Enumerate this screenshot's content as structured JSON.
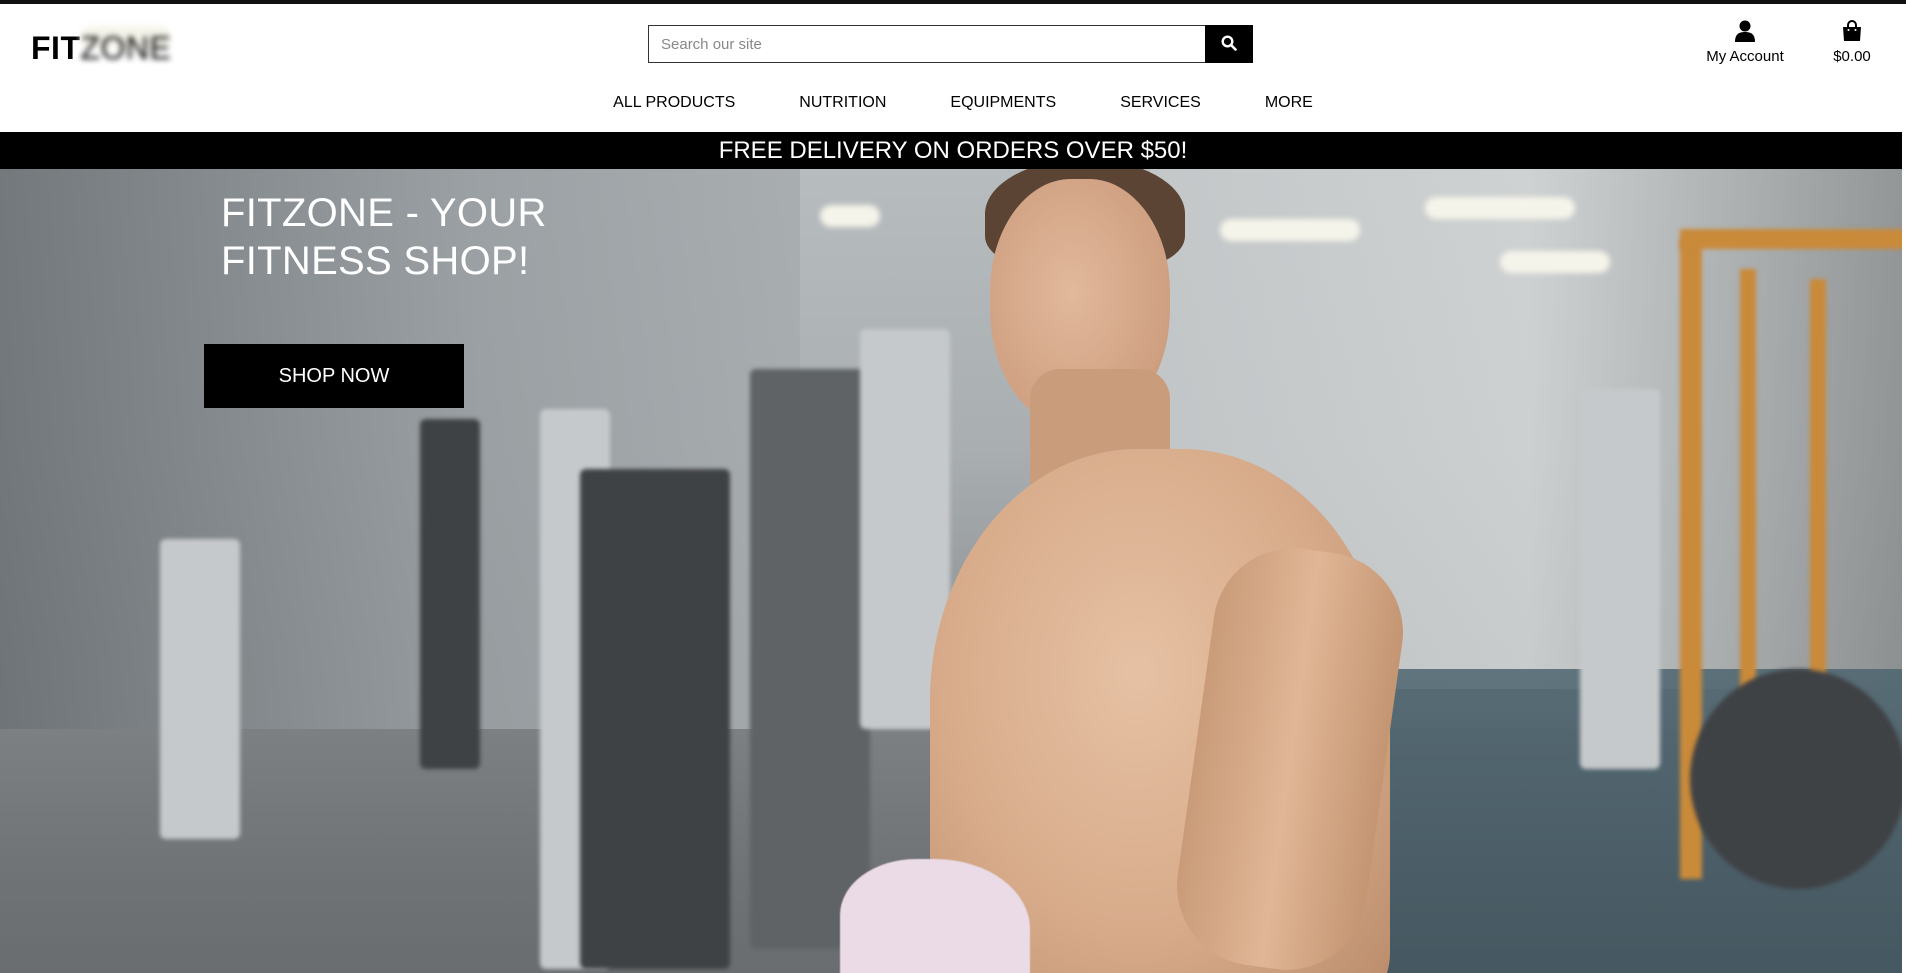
{
  "header": {
    "logo_bold": "FIT",
    "logo_light": "ZONE",
    "search": {
      "placeholder": "Search our site",
      "value": ""
    },
    "account_label": "My Account",
    "cart_total": "$0.00"
  },
  "nav": {
    "items": [
      "ALL PRODUCTS",
      "NUTRITION",
      "EQUIPMENTS",
      "SERVICES",
      "MORE"
    ]
  },
  "banner": {
    "text": "FREE DELIVERY ON ORDERS OVER $50!"
  },
  "hero": {
    "title_line1": "FITZONE - YOUR",
    "title_line2": "FITNESS SHOP!",
    "cta_label": "SHOP NOW"
  },
  "icons": {
    "search": "search-icon",
    "account": "user-icon",
    "cart": "shopping-bag-icon"
  },
  "colors": {
    "primary": "#000000",
    "background": "#ffffff",
    "banner_text": "#ffffff"
  }
}
